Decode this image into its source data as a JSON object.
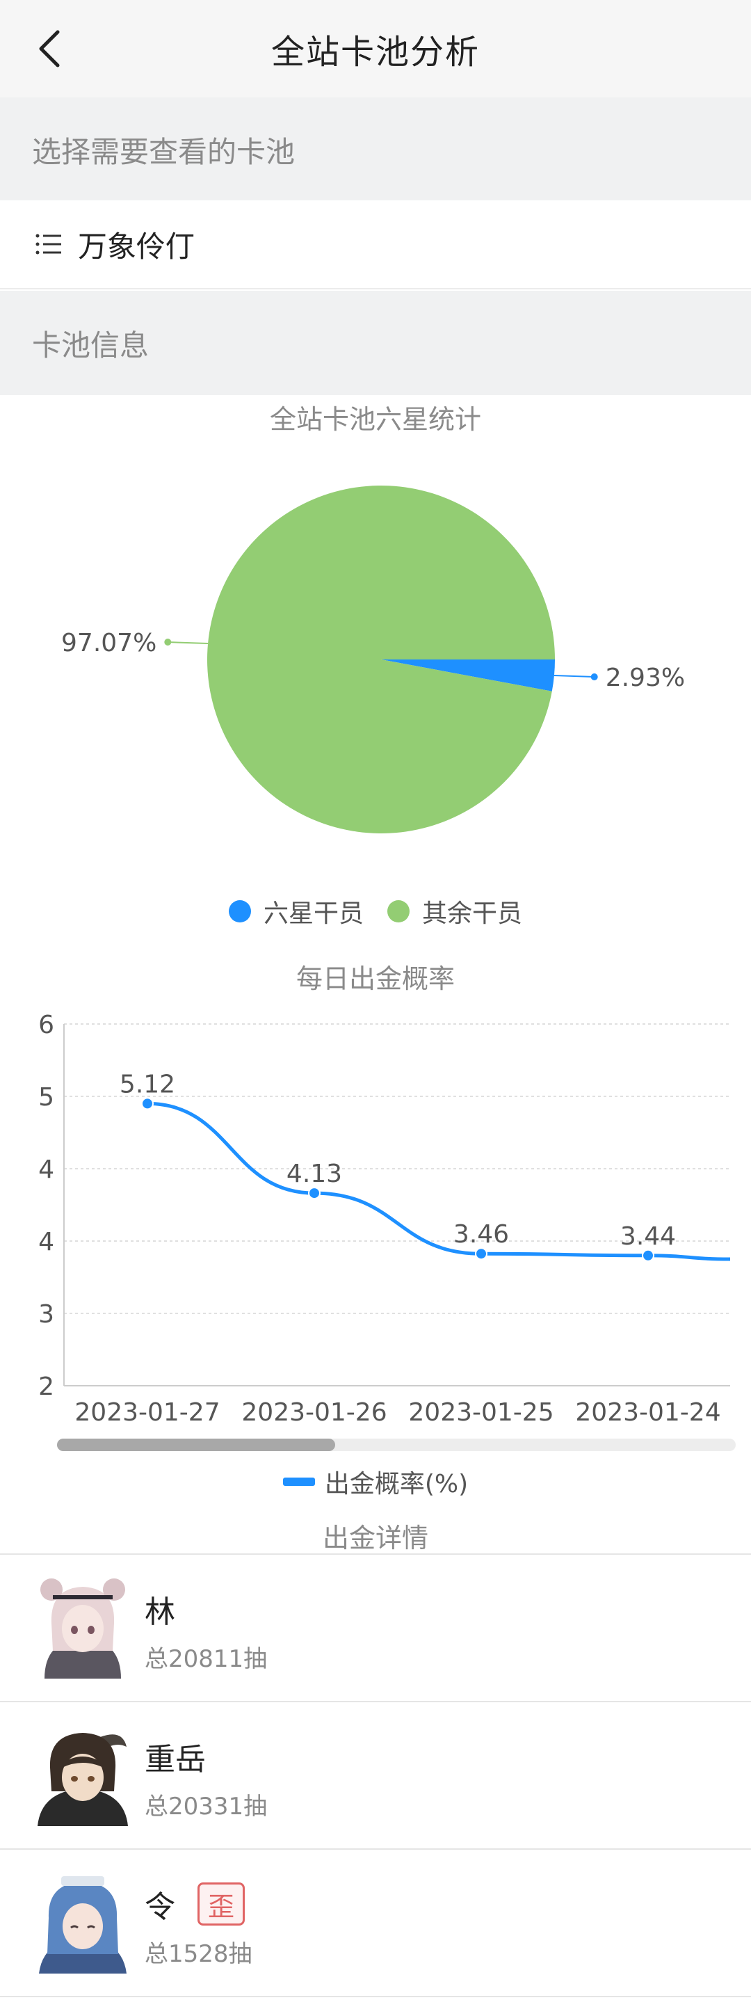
{
  "header": {
    "title": "全站卡池分析"
  },
  "sections": {
    "select_pool": "选择需要查看的卡池",
    "pool_info": "卡池信息"
  },
  "pool": {
    "selected": "万象伶仃"
  },
  "colors": {
    "blue": "#1e90ff",
    "green": "#93cd73",
    "badge_red": "#e06464"
  },
  "chart_data": [
    {
      "type": "pie",
      "title": "全站卡池六星统计",
      "slices": [
        {
          "name": "六星干员",
          "value": 2.93,
          "label": "2.93%",
          "color": "#1e90ff"
        },
        {
          "name": "其余干员",
          "value": 97.07,
          "label": "97.07%",
          "color": "#93cd73"
        }
      ],
      "legend": [
        "六星干员",
        "其余干员"
      ],
      "legend_position": "bottom"
    },
    {
      "type": "line",
      "title": "每日出金概率",
      "x": [
        "2023-01-27",
        "2023-01-26",
        "2023-01-25",
        "2023-01-24"
      ],
      "series": [
        {
          "name": "出金概率(%)",
          "values": [
            5.12,
            4.13,
            3.46,
            3.44
          ],
          "labels": [
            "5.12",
            "4.13",
            "3.46",
            "3.44"
          ]
        }
      ],
      "trailing_value": 3.4,
      "y_ticks": [
        "2",
        "3",
        "4",
        "4",
        "5",
        "6"
      ],
      "ylim": [
        2,
        6
      ],
      "grid": true,
      "legend_position": "bottom"
    }
  ],
  "detail": {
    "title": "出金详情",
    "items": [
      {
        "name": "林",
        "sub": "总20811抽",
        "badge": ""
      },
      {
        "name": "重岳",
        "sub": "总20331抽",
        "badge": ""
      },
      {
        "name": "令",
        "sub": "总1528抽",
        "badge": "歪"
      }
    ]
  }
}
